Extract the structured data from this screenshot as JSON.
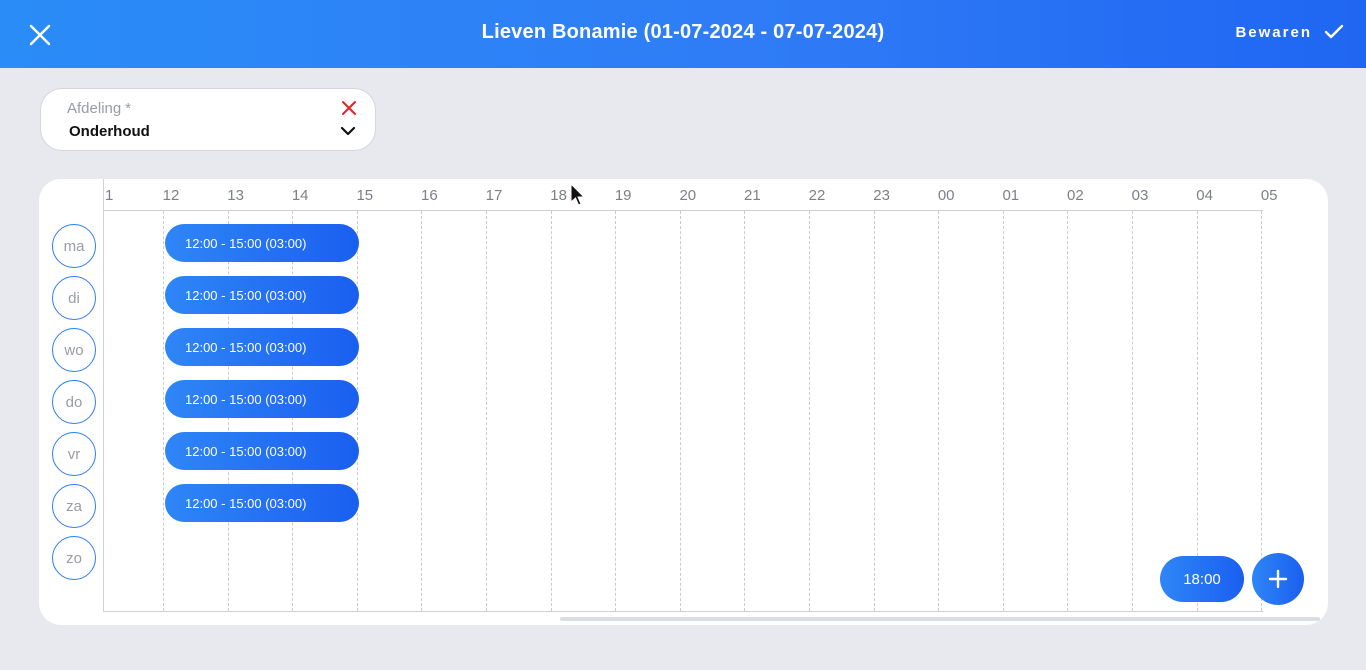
{
  "header": {
    "title": "Lieven Bonamie (01-07-2024 - 07-07-2024)",
    "save_label": "Bewaren",
    "background": "#2f7cf6"
  },
  "department": {
    "label": "Afdeling",
    "required_mark": "*",
    "value": "Onderhoud",
    "clear_color": "#e02424"
  },
  "timeline": {
    "hours": [
      "1",
      "12",
      "13",
      "14",
      "15",
      "16",
      "17",
      "18",
      "19",
      "20",
      "21",
      "22",
      "23",
      "00",
      "01",
      "02",
      "03",
      "04",
      "05"
    ]
  },
  "days": [
    {
      "label": "ma",
      "shift": "12:00 - 15:00 (03:00)"
    },
    {
      "label": "di",
      "shift": "12:00 - 15:00 (03:00)"
    },
    {
      "label": "wo",
      "shift": "12:00 - 15:00 (03:00)"
    },
    {
      "label": "do",
      "shift": "12:00 - 15:00 (03:00)"
    },
    {
      "label": "vr",
      "shift": "12:00 - 15:00 (03:00)"
    },
    {
      "label": "za",
      "shift": "12:00 - 15:00 (03:00)"
    },
    {
      "label": "zo",
      "shift": null
    }
  ],
  "actions": {
    "time_pill": "18:00"
  },
  "accent": "#2f7cf6"
}
